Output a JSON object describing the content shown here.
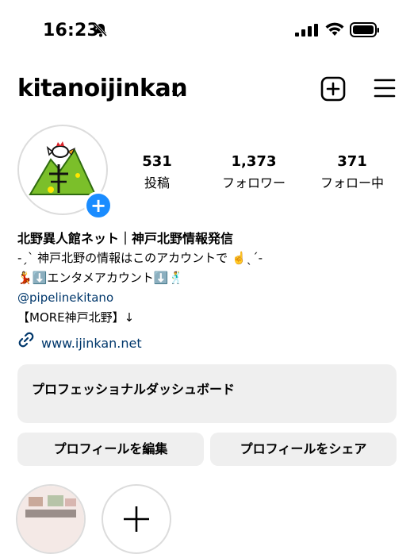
{
  "status_bar": {
    "time": "16:23",
    "icons": [
      "bell-slash-icon",
      "cellular-signal-icon",
      "wifi-icon",
      "battery-icon"
    ]
  },
  "header": {
    "username": "kitanoijinkan",
    "icons": [
      "chevron-down-icon",
      "add-square-icon",
      "hamburger-menu-icon"
    ]
  },
  "profile": {
    "stats": [
      {
        "value": "531",
        "label": "投稿"
      },
      {
        "value": "1,373",
        "label": "フォロワー"
      },
      {
        "value": "371",
        "label": "フォロー中"
      }
    ],
    "bio": {
      "name": "北野異人館ネット｜神戸北野情報発信",
      "line1": "-ˏˋ 神戸北野の情報はこのアカウントで ☝️ˎˊ-",
      "line2": "💃⬇️エンタメアカウント⬇️🕺",
      "mention": "@pipelinekitano",
      "line3": "【MORE神戸北野】↓",
      "link": "www.ijinkan.net"
    }
  },
  "dashboard": {
    "label": "プロフェッショナルダッシュボード"
  },
  "buttons": {
    "edit_profile": "プロフィールを編集",
    "share_profile": "プロフィールをシェア"
  },
  "colors": {
    "accent_blue": "#1a8cff",
    "link_blue": "#00376b",
    "button_bg": "#efefef"
  }
}
